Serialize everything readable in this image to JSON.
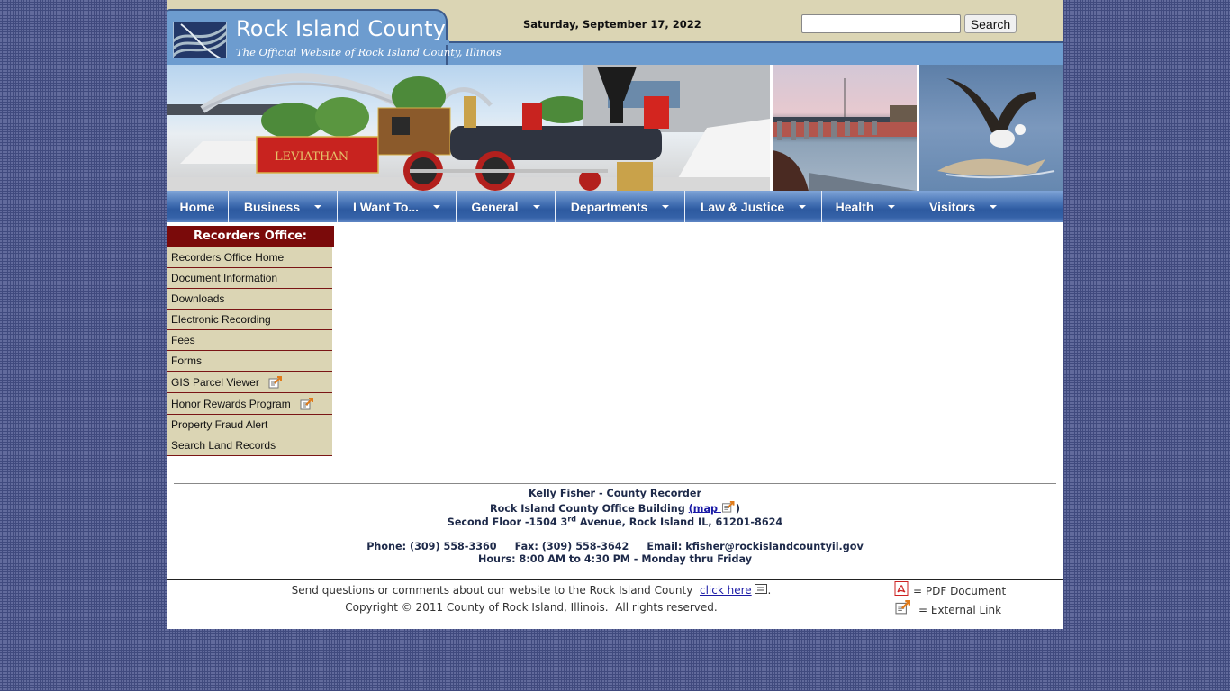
{
  "header": {
    "title": "Rock Island County",
    "tagline": "The Official Website of Rock Island County, Illinois",
    "date": "Saturday, September 17, 2022",
    "search": {
      "value": "",
      "placeholder": "",
      "button_label": "Search"
    },
    "logo_icon": "river-waves-logo"
  },
  "banner": {
    "photos": [
      {
        "name": "leviathan-train-photo",
        "caption": "LEVIATHAN"
      },
      {
        "name": "lock-and-dam-photo"
      },
      {
        "name": "bald-eagle-photo"
      }
    ]
  },
  "nav": {
    "items": [
      {
        "label": "Home",
        "has_dropdown": false
      },
      {
        "label": "Business",
        "has_dropdown": true
      },
      {
        "label": "I Want To...",
        "has_dropdown": true
      },
      {
        "label": "General",
        "has_dropdown": true
      },
      {
        "label": "Departments",
        "has_dropdown": true
      },
      {
        "label": "Law & Justice",
        "has_dropdown": true
      },
      {
        "label": "Health",
        "has_dropdown": true
      },
      {
        "label": "Visitors",
        "has_dropdown": true
      }
    ]
  },
  "sidebar": {
    "title": "Recorders Office:",
    "items": [
      {
        "label": "Recorders Office Home",
        "external": false
      },
      {
        "label": "Document Information",
        "external": false
      },
      {
        "label": "Downloads",
        "external": false
      },
      {
        "label": "Electronic Recording",
        "external": false
      },
      {
        "label": "Fees",
        "external": false
      },
      {
        "label": "Forms",
        "external": false
      },
      {
        "label": "GIS Parcel Viewer",
        "external": true
      },
      {
        "label": "Honor Rewards Program",
        "external": true
      },
      {
        "label": "Property Fraud Alert",
        "external": false
      },
      {
        "label": "Search Land Records",
        "external": false
      }
    ]
  },
  "contact": {
    "name_line": "Kelly Fisher - County Recorder",
    "building_prefix": "Rock Island County Office Building ",
    "map_open": "(",
    "map_label": "map ",
    "map_close": ")",
    "address_prefix": "Second Floor -1504 3",
    "address_sup": "rd",
    "address_suffix": " Avenue, Rock Island IL, 61201-8624",
    "phone": "Phone: (309) 558-3360",
    "fax": "Fax: (309) 558-3642",
    "email": "Email: kfisher@rockislandcountyil.gov",
    "hours": "Hours: 8:00 AM to 4:30 PM - Monday thru Friday"
  },
  "footer": {
    "feedback_prefix": "Send questions or comments about our website to the Rock Island County  ",
    "feedback_link": "click here",
    "feedback_suffix": ".",
    "copyright": "Copyright © 2011 County of Rock Island, Illinois.  All rights reserved.",
    "legend": [
      {
        "icon": "pdf-icon",
        "label": "= PDF Document"
      },
      {
        "icon": "external-link-icon",
        "label": "= External Link"
      }
    ]
  },
  "colors": {
    "page_background": "#404a7e",
    "header_tan": "#dbd5b4",
    "header_blue": "#6d9ccf",
    "nav_blue": "#2d5aa0",
    "sidebar_header": "#7a0a0a",
    "sidebar_item": "#dbd5b4",
    "link": "#1a1aa6"
  }
}
